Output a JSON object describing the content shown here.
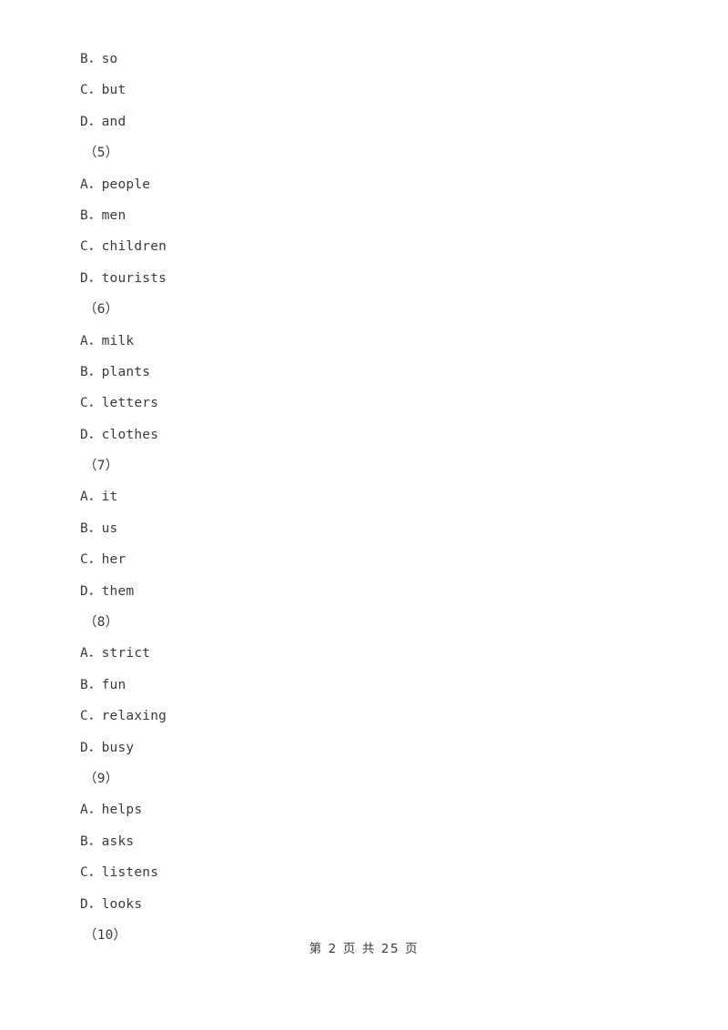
{
  "document": {
    "page_background": "#ffffff",
    "text_color": "#3a3a3a",
    "lines": [
      {
        "kind": "option",
        "text": "B．so"
      },
      {
        "kind": "option",
        "text": "C．but"
      },
      {
        "kind": "option",
        "text": "D．and"
      },
      {
        "kind": "qnum",
        "text": "（5）"
      },
      {
        "kind": "option",
        "text": "A．people"
      },
      {
        "kind": "option",
        "text": "B．men"
      },
      {
        "kind": "option",
        "text": "C．children"
      },
      {
        "kind": "option",
        "text": "D．tourists"
      },
      {
        "kind": "qnum",
        "text": "（6）"
      },
      {
        "kind": "option",
        "text": "A．milk"
      },
      {
        "kind": "option",
        "text": "B．plants"
      },
      {
        "kind": "option",
        "text": "C．letters"
      },
      {
        "kind": "option",
        "text": "D．clothes"
      },
      {
        "kind": "qnum",
        "text": "（7）"
      },
      {
        "kind": "option",
        "text": "A．it"
      },
      {
        "kind": "option",
        "text": "B．us"
      },
      {
        "kind": "option",
        "text": "C．her"
      },
      {
        "kind": "option",
        "text": "D．them"
      },
      {
        "kind": "qnum",
        "text": "（8）"
      },
      {
        "kind": "option",
        "text": "A．strict"
      },
      {
        "kind": "option",
        "text": "B．fun"
      },
      {
        "kind": "option",
        "text": "C．relaxing"
      },
      {
        "kind": "option",
        "text": "D．busy"
      },
      {
        "kind": "qnum",
        "text": "（9）"
      },
      {
        "kind": "option",
        "text": "A．helps"
      },
      {
        "kind": "option",
        "text": "B．asks"
      },
      {
        "kind": "option",
        "text": "C．listens"
      },
      {
        "kind": "option",
        "text": "D．looks"
      },
      {
        "kind": "qnum",
        "text": "（10）"
      }
    ]
  },
  "footer": {
    "page_label": "第 2 页 共 25 页",
    "current_page": 2,
    "total_pages": 25
  }
}
